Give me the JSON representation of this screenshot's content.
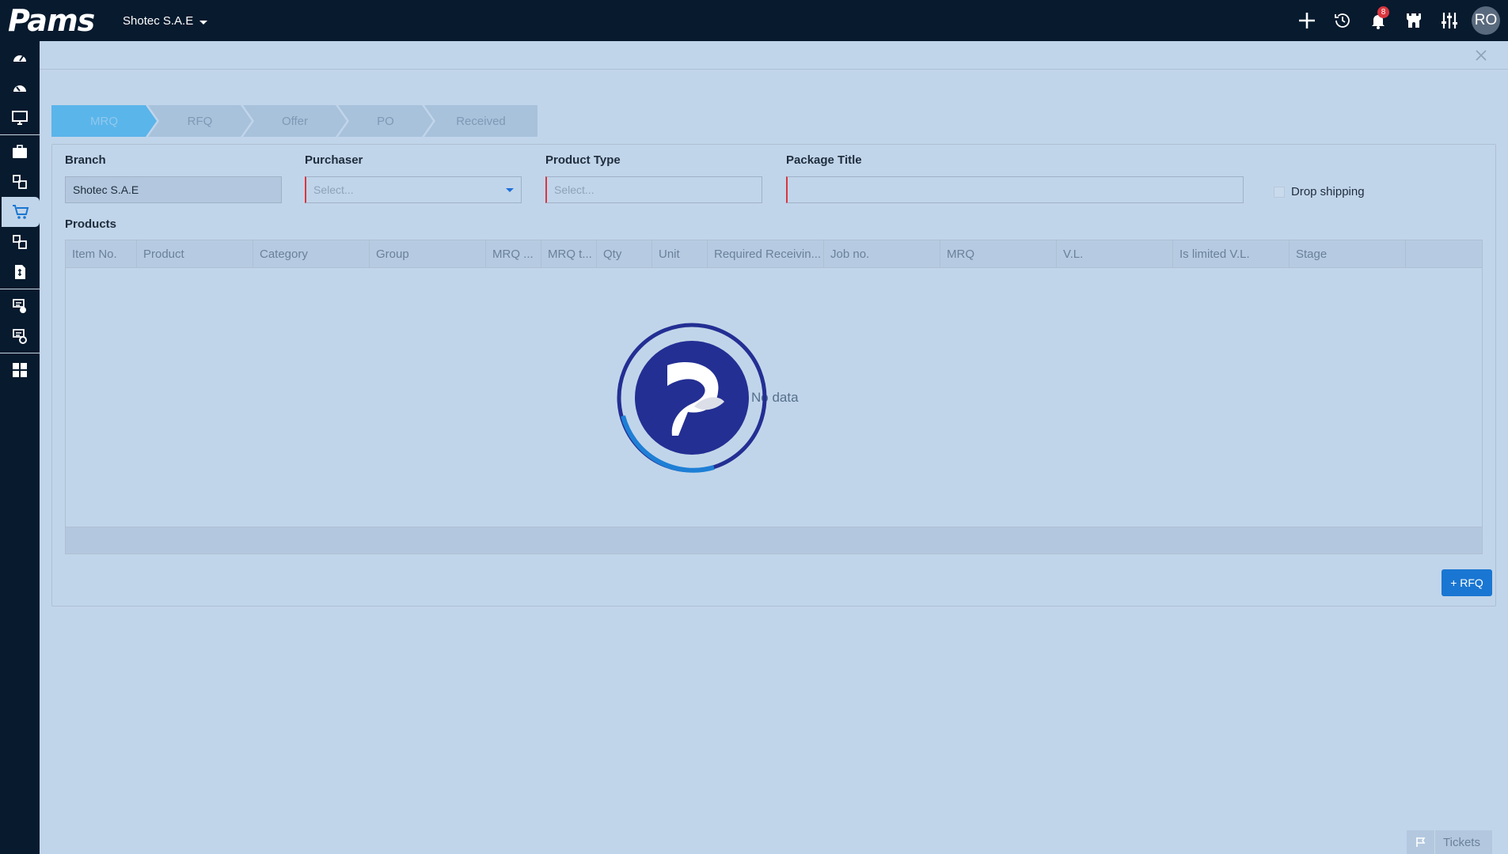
{
  "header": {
    "logo_text": "Pams",
    "company": "Shotec S.A.E",
    "notification_count": "8",
    "avatar_initials": "RO"
  },
  "sidebar": {
    "items": [
      {
        "name": "dashboard-icon"
      },
      {
        "name": "dashboard-alt-icon"
      },
      {
        "name": "monitor-icon"
      },
      {
        "name": "briefcase-icon"
      },
      {
        "name": "modules-icon"
      },
      {
        "name": "cart-icon",
        "active": true
      },
      {
        "name": "modules-alt-icon"
      },
      {
        "name": "invoice-icon"
      },
      {
        "name": "document-check-icon"
      },
      {
        "name": "document-gear-icon"
      },
      {
        "name": "grid-icon"
      }
    ]
  },
  "steps": [
    "MRQ",
    "RFQ",
    "Offer",
    "PO",
    "Received"
  ],
  "form": {
    "branch_label": "Branch",
    "branch_value": "Shotec S.A.E",
    "purchaser_label": "Purchaser",
    "purchaser_placeholder": "Select...",
    "product_type_label": "Product Type",
    "product_type_placeholder": "Select...",
    "package_title_label": "Package Title",
    "package_title_value": "",
    "drop_shipping_label": "Drop shipping",
    "products_label": "Products"
  },
  "table": {
    "columns": [
      "Item No.",
      "Product",
      "Category",
      "Group",
      "MRQ ...",
      "MRQ t...",
      "Qty",
      "Unit",
      "Required Receivin...",
      "Job no.",
      "MRQ",
      "V.L.",
      "Is limited V.L.",
      "Stage",
      ""
    ],
    "empty_text": "No data"
  },
  "actions": {
    "add_rfq": "+ RFQ"
  },
  "footer": {
    "tickets": "Tickets"
  },
  "colors": {
    "topbar": "#071a2e",
    "background": "#c1d5ea",
    "primary": "#1976d2",
    "active_step": "#5ab5ea",
    "required": "#d9363e"
  }
}
